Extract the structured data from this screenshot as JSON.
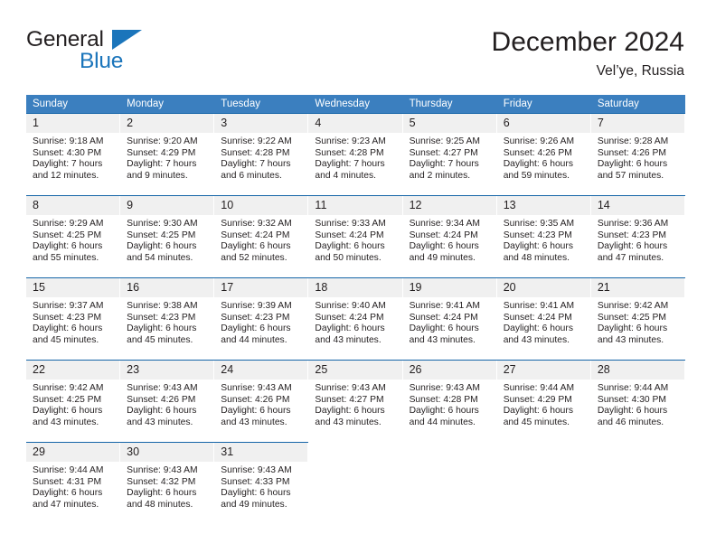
{
  "brand": {
    "name_part1": "General",
    "name_part2": "Blue",
    "color_dark": "#231f20",
    "color_blue": "#1b75bb"
  },
  "header": {
    "title": "December 2024",
    "subtitle": "Vel’ye, Russia"
  },
  "theme": {
    "header_blue": "#3b7fbf",
    "row_line_blue": "#1565a8",
    "daynum_background": "#f0f0f0",
    "text": "#231f20"
  },
  "labels": {
    "sunrise_prefix": "Sunrise:",
    "sunset_prefix": "Sunset:",
    "daylight_prefix": "Daylight:"
  },
  "weekdays": [
    "Sunday",
    "Monday",
    "Tuesday",
    "Wednesday",
    "Thursday",
    "Friday",
    "Saturday"
  ],
  "weeks": [
    [
      {
        "day": "1",
        "sunrise": "Sunrise: 9:18 AM",
        "sunset": "Sunset: 4:30 PM",
        "daylight_line1": "Daylight: 7 hours",
        "daylight_line2": "and 12 minutes."
      },
      {
        "day": "2",
        "sunrise": "Sunrise: 9:20 AM",
        "sunset": "Sunset: 4:29 PM",
        "daylight_line1": "Daylight: 7 hours",
        "daylight_line2": "and 9 minutes."
      },
      {
        "day": "3",
        "sunrise": "Sunrise: 9:22 AM",
        "sunset": "Sunset: 4:28 PM",
        "daylight_line1": "Daylight: 7 hours",
        "daylight_line2": "and 6 minutes."
      },
      {
        "day": "4",
        "sunrise": "Sunrise: 9:23 AM",
        "sunset": "Sunset: 4:28 PM",
        "daylight_line1": "Daylight: 7 hours",
        "daylight_line2": "and 4 minutes."
      },
      {
        "day": "5",
        "sunrise": "Sunrise: 9:25 AM",
        "sunset": "Sunset: 4:27 PM",
        "daylight_line1": "Daylight: 7 hours",
        "daylight_line2": "and 2 minutes."
      },
      {
        "day": "6",
        "sunrise": "Sunrise: 9:26 AM",
        "sunset": "Sunset: 4:26 PM",
        "daylight_line1": "Daylight: 6 hours",
        "daylight_line2": "and 59 minutes."
      },
      {
        "day": "7",
        "sunrise": "Sunrise: 9:28 AM",
        "sunset": "Sunset: 4:26 PM",
        "daylight_line1": "Daylight: 6 hours",
        "daylight_line2": "and 57 minutes."
      }
    ],
    [
      {
        "day": "8",
        "sunrise": "Sunrise: 9:29 AM",
        "sunset": "Sunset: 4:25 PM",
        "daylight_line1": "Daylight: 6 hours",
        "daylight_line2": "and 55 minutes."
      },
      {
        "day": "9",
        "sunrise": "Sunrise: 9:30 AM",
        "sunset": "Sunset: 4:25 PM",
        "daylight_line1": "Daylight: 6 hours",
        "daylight_line2": "and 54 minutes."
      },
      {
        "day": "10",
        "sunrise": "Sunrise: 9:32 AM",
        "sunset": "Sunset: 4:24 PM",
        "daylight_line1": "Daylight: 6 hours",
        "daylight_line2": "and 52 minutes."
      },
      {
        "day": "11",
        "sunrise": "Sunrise: 9:33 AM",
        "sunset": "Sunset: 4:24 PM",
        "daylight_line1": "Daylight: 6 hours",
        "daylight_line2": "and 50 minutes."
      },
      {
        "day": "12",
        "sunrise": "Sunrise: 9:34 AM",
        "sunset": "Sunset: 4:24 PM",
        "daylight_line1": "Daylight: 6 hours",
        "daylight_line2": "and 49 minutes."
      },
      {
        "day": "13",
        "sunrise": "Sunrise: 9:35 AM",
        "sunset": "Sunset: 4:23 PM",
        "daylight_line1": "Daylight: 6 hours",
        "daylight_line2": "and 48 minutes."
      },
      {
        "day": "14",
        "sunrise": "Sunrise: 9:36 AM",
        "sunset": "Sunset: 4:23 PM",
        "daylight_line1": "Daylight: 6 hours",
        "daylight_line2": "and 47 minutes."
      }
    ],
    [
      {
        "day": "15",
        "sunrise": "Sunrise: 9:37 AM",
        "sunset": "Sunset: 4:23 PM",
        "daylight_line1": "Daylight: 6 hours",
        "daylight_line2": "and 45 minutes."
      },
      {
        "day": "16",
        "sunrise": "Sunrise: 9:38 AM",
        "sunset": "Sunset: 4:23 PM",
        "daylight_line1": "Daylight: 6 hours",
        "daylight_line2": "and 45 minutes."
      },
      {
        "day": "17",
        "sunrise": "Sunrise: 9:39 AM",
        "sunset": "Sunset: 4:23 PM",
        "daylight_line1": "Daylight: 6 hours",
        "daylight_line2": "and 44 minutes."
      },
      {
        "day": "18",
        "sunrise": "Sunrise: 9:40 AM",
        "sunset": "Sunset: 4:24 PM",
        "daylight_line1": "Daylight: 6 hours",
        "daylight_line2": "and 43 minutes."
      },
      {
        "day": "19",
        "sunrise": "Sunrise: 9:41 AM",
        "sunset": "Sunset: 4:24 PM",
        "daylight_line1": "Daylight: 6 hours",
        "daylight_line2": "and 43 minutes."
      },
      {
        "day": "20",
        "sunrise": "Sunrise: 9:41 AM",
        "sunset": "Sunset: 4:24 PM",
        "daylight_line1": "Daylight: 6 hours",
        "daylight_line2": "and 43 minutes."
      },
      {
        "day": "21",
        "sunrise": "Sunrise: 9:42 AM",
        "sunset": "Sunset: 4:25 PM",
        "daylight_line1": "Daylight: 6 hours",
        "daylight_line2": "and 43 minutes."
      }
    ],
    [
      {
        "day": "22",
        "sunrise": "Sunrise: 9:42 AM",
        "sunset": "Sunset: 4:25 PM",
        "daylight_line1": "Daylight: 6 hours",
        "daylight_line2": "and 43 minutes."
      },
      {
        "day": "23",
        "sunrise": "Sunrise: 9:43 AM",
        "sunset": "Sunset: 4:26 PM",
        "daylight_line1": "Daylight: 6 hours",
        "daylight_line2": "and 43 minutes."
      },
      {
        "day": "24",
        "sunrise": "Sunrise: 9:43 AM",
        "sunset": "Sunset: 4:26 PM",
        "daylight_line1": "Daylight: 6 hours",
        "daylight_line2": "and 43 minutes."
      },
      {
        "day": "25",
        "sunrise": "Sunrise: 9:43 AM",
        "sunset": "Sunset: 4:27 PM",
        "daylight_line1": "Daylight: 6 hours",
        "daylight_line2": "and 43 minutes."
      },
      {
        "day": "26",
        "sunrise": "Sunrise: 9:43 AM",
        "sunset": "Sunset: 4:28 PM",
        "daylight_line1": "Daylight: 6 hours",
        "daylight_line2": "and 44 minutes."
      },
      {
        "day": "27",
        "sunrise": "Sunrise: 9:44 AM",
        "sunset": "Sunset: 4:29 PM",
        "daylight_line1": "Daylight: 6 hours",
        "daylight_line2": "and 45 minutes."
      },
      {
        "day": "28",
        "sunrise": "Sunrise: 9:44 AM",
        "sunset": "Sunset: 4:30 PM",
        "daylight_line1": "Daylight: 6 hours",
        "daylight_line2": "and 46 minutes."
      }
    ],
    [
      {
        "day": "29",
        "sunrise": "Sunrise: 9:44 AM",
        "sunset": "Sunset: 4:31 PM",
        "daylight_line1": "Daylight: 6 hours",
        "daylight_line2": "and 47 minutes."
      },
      {
        "day": "30",
        "sunrise": "Sunrise: 9:43 AM",
        "sunset": "Sunset: 4:32 PM",
        "daylight_line1": "Daylight: 6 hours",
        "daylight_line2": "and 48 minutes."
      },
      {
        "day": "31",
        "sunrise": "Sunrise: 9:43 AM",
        "sunset": "Sunset: 4:33 PM",
        "daylight_line1": "Daylight: 6 hours",
        "daylight_line2": "and 49 minutes."
      },
      {
        "day": "",
        "sunrise": "",
        "sunset": "",
        "daylight_line1": "",
        "daylight_line2": ""
      },
      {
        "day": "",
        "sunrise": "",
        "sunset": "",
        "daylight_line1": "",
        "daylight_line2": ""
      },
      {
        "day": "",
        "sunrise": "",
        "sunset": "",
        "daylight_line1": "",
        "daylight_line2": ""
      },
      {
        "day": "",
        "sunrise": "",
        "sunset": "",
        "daylight_line1": "",
        "daylight_line2": ""
      }
    ]
  ]
}
